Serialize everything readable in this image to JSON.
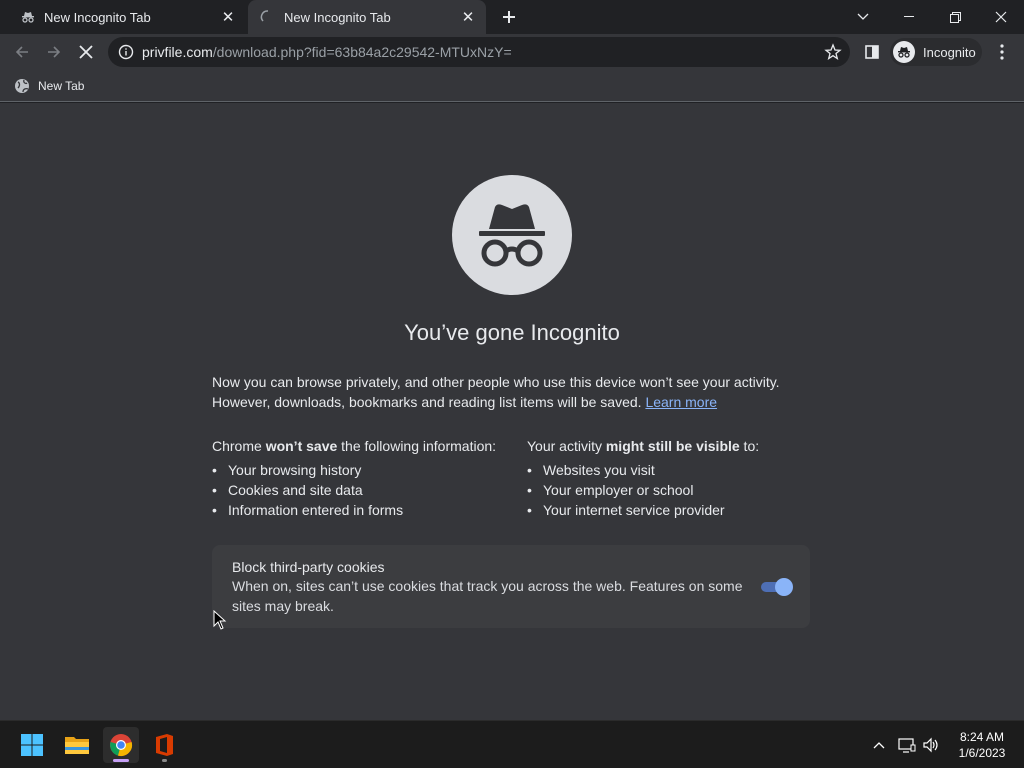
{
  "tabs": [
    {
      "label": "New Incognito Tab",
      "icon": "incognito-icon",
      "active": false
    },
    {
      "label": "New Incognito Tab",
      "icon": "loading-spinner-icon",
      "active": true
    }
  ],
  "window_controls": [
    "tab-search-icon",
    "minimize-icon",
    "restore-icon",
    "close-icon"
  ],
  "toolbar": {
    "url_host": "privfile.com",
    "url_path": "/download.php?fid=63b84a2c29542-MTUxNzY=",
    "profile_label": "Incognito"
  },
  "bookmarks": [
    {
      "label": "New Tab",
      "icon": "globe-icon"
    }
  ],
  "page": {
    "heading": "You’ve gone Incognito",
    "intro_line1": "Now you can browse privately, and other people who use this device won’t see your activity.",
    "intro_line2": "However, downloads, bookmarks and reading list items will be saved.",
    "learn_more": "Learn more",
    "col1_prefix": "Chrome ",
    "col1_bold": "won’t save",
    "col1_suffix": " the following information:",
    "col1_items": [
      "Your browsing history",
      "Cookies and site data",
      "Information entered in forms"
    ],
    "col2_prefix": "Your activity ",
    "col2_bold": "might still be visible",
    "col2_suffix": " to:",
    "col2_items": [
      "Websites you visit",
      "Your employer or school",
      "Your internet service provider"
    ],
    "cookies_title": "Block third-party cookies",
    "cookies_desc": "When on, sites can’t use cookies that track you across the web. Features on some sites may break.",
    "cookies_toggle_on": true
  },
  "taskbar": {
    "apps": [
      "windows-start-icon",
      "file-explorer-icon",
      "chrome-icon",
      "office-icon"
    ],
    "time": "8:24 AM",
    "date": "1/6/2023"
  },
  "colors": {
    "accent": "#8ab4f8",
    "background": "#35363a",
    "tabstrip": "#202124"
  }
}
